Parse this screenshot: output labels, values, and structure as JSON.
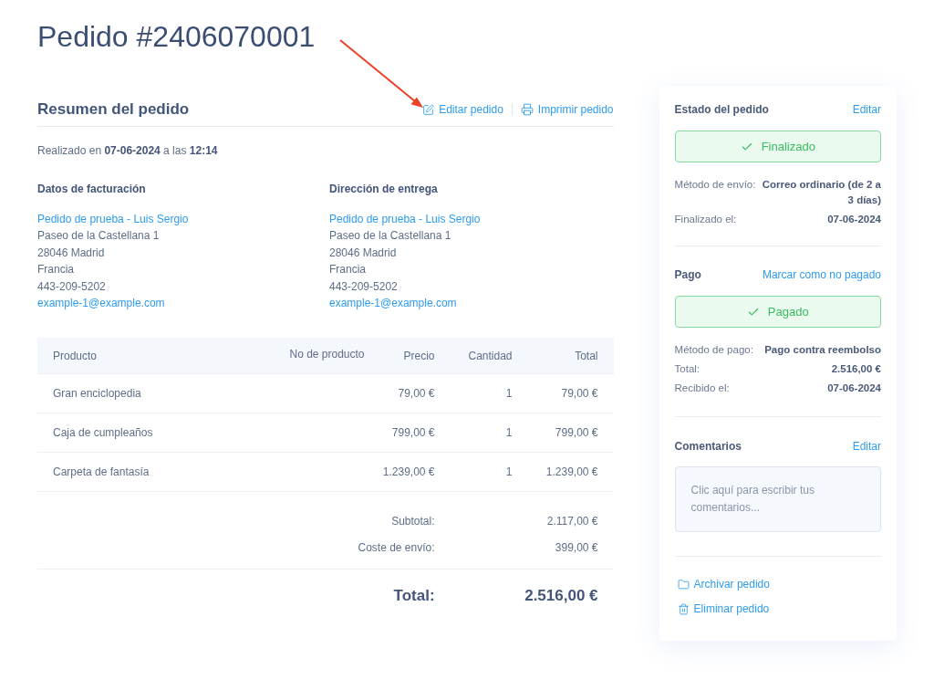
{
  "page": {
    "title": "Pedido #2406070001"
  },
  "summary": {
    "title": "Resumen del pedido",
    "actions": [
      {
        "kind": "edit",
        "label": "Editar pedido"
      },
      {
        "kind": "print",
        "label": "Imprimir pedido"
      }
    ],
    "placed": "Realizado en **07-06-2024** a las **12:14**",
    "addresses": [
      {
        "title": "Datos de facturación",
        "name": "Pedido de prueba - Luis Sergio",
        "lines": [
          "Paseo de la Castellana 1",
          "28046 Madrid",
          "Francia",
          "443-209-5202"
        ],
        "email": "example-1@example.com"
      },
      {
        "title": "Dirección de entrega",
        "name": "Pedido de prueba - Luis Sergio",
        "lines": [
          "Paseo de la Castellana 1",
          "28046 Madrid",
          "Francia",
          "443-209-5202"
        ],
        "email": "example-1@example.com"
      }
    ]
  },
  "table": {
    "columns": [
      "Producto",
      "No de producto",
      "Precio",
      "Cantidad",
      "Total"
    ],
    "rows": [
      {
        "product": "Gran enciclopedia",
        "price": "79,00 €",
        "quantity": "1",
        "total": "79,00 €"
      },
      {
        "product": "Caja de cumpleaños",
        "price": "799,00 €",
        "quantity": "1",
        "total": "799,00 €"
      },
      {
        "product": "Carpeta de fantasía",
        "price": "1.239,00 €",
        "quantity": "1",
        "total": "1.239,00 €"
      }
    ],
    "totals": [
      {
        "label": "Subtotal:",
        "value": "2.117,00 €"
      },
      {
        "label": "Coste de envío:",
        "value": "399,00 €"
      }
    ],
    "grand_total": {
      "label": "Total:",
      "value": "2.516,00 €"
    }
  },
  "sidebar": {
    "status": {
      "title": "Estado del pedido",
      "action": "Editar",
      "badge": "Finalizado",
      "details": [
        {
          "label": "Método de envío:",
          "value": "Correo ordinario (de 2 a 3 días)"
        },
        {
          "label": "Finalizado el:",
          "value": "07-06-2024"
        }
      ]
    },
    "payment": {
      "title": "Pago",
      "action": "Marcar como no pagado",
      "badge": "Pagado",
      "details": [
        {
          "label": "Método de pago:",
          "value": "Pago contra reembolso"
        },
        {
          "label": "Total:",
          "value": "2.516,00 €"
        },
        {
          "label": "Recibido el:",
          "value": "07-06-2024"
        }
      ]
    },
    "comments": {
      "title": "Comentarios",
      "action": "Editar",
      "placeholder": "Clic aquí para escribir tus comentarios..."
    },
    "order_actions": [
      {
        "kind": "archive",
        "label": "Archivar pedido"
      },
      {
        "kind": "delete",
        "label": "Eliminar pedido"
      }
    ]
  }
}
